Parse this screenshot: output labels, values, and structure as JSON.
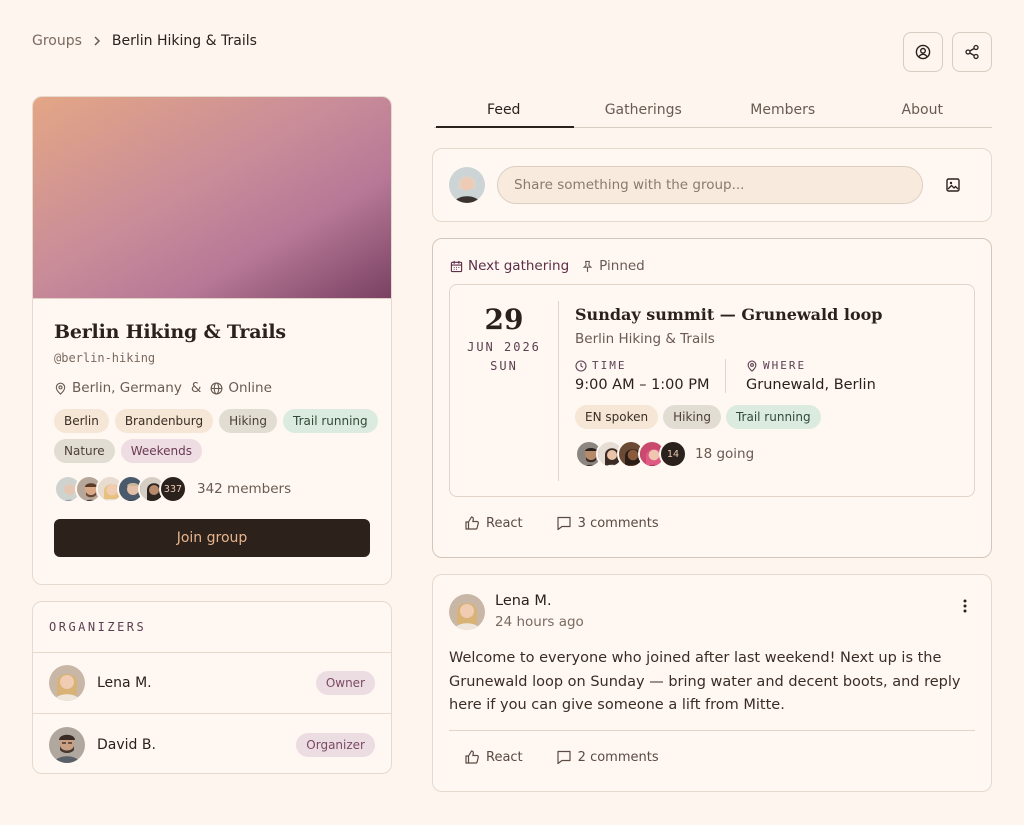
{
  "breadcrumb": {
    "parent": "Groups",
    "current": "Berlin Hiking & Trails"
  },
  "group": {
    "name": "Berlin Hiking & Trails",
    "handle": "@berlin-hiking",
    "location": "Berlin, Germany",
    "location_sep": "&",
    "online": "Online",
    "tags": [
      {
        "label": "Berlin",
        "style": "neutral"
      },
      {
        "label": "Brandenburg",
        "style": "neutral"
      },
      {
        "label": "Hiking",
        "style": "grey"
      },
      {
        "label": "Trail running",
        "style": "green"
      },
      {
        "label": "Nature",
        "style": "grey"
      },
      {
        "label": "Weekends",
        "style": "pink"
      }
    ],
    "members_more": "337",
    "members_text": "342 members",
    "join_label": "Join group"
  },
  "organizers": {
    "title": "ORGANIZERS",
    "items": [
      {
        "name": "Lena M.",
        "role": "Owner"
      },
      {
        "name": "David B.",
        "role": "Organizer"
      }
    ]
  },
  "tabs": [
    "Feed",
    "Gatherings",
    "Members",
    "About"
  ],
  "active_tab": "Feed",
  "composer": {
    "placeholder": "Share something with the group..."
  },
  "gathering": {
    "header_label": "Next gathering",
    "pinned_label": "Pinned",
    "day": "29",
    "month_year": "JUN 2026",
    "weekday": "SUN",
    "title": "Sunday summit — Grunewald loop",
    "group": "Berlin Hiking & Trails",
    "time_label": "TIME",
    "time_value": "9:00 AM – 1:00 PM",
    "where_label": "WHERE",
    "where_value": "Grunewald, Berlin",
    "tags": [
      {
        "label": "EN spoken",
        "style": "neutral"
      },
      {
        "label": "Hiking",
        "style": "grey"
      },
      {
        "label": "Trail running",
        "style": "green"
      }
    ],
    "going_more": "14",
    "going_text": "18 going",
    "react_label": "React",
    "comments_label": "3 comments"
  },
  "post": {
    "author": "Lena M.",
    "time": "24 hours ago",
    "text": "Welcome to everyone who joined after last weekend! Next up is the Grunewald loop on Sunday — bring water and decent boots, and reply here if you can give someone a lift from Mitte.",
    "react_label": "React",
    "comments_label": "2 comments"
  },
  "colors": {
    "accent": "#5b2d48",
    "dark": "#2c211b",
    "join_text": "#e8b48d"
  },
  "icons": [
    "chevron-right-icon",
    "user-circle-icon",
    "share-icon",
    "map-pin-icon",
    "globe-icon",
    "image-icon",
    "calendar-icon",
    "pin-icon",
    "clock-icon",
    "thumbs-up-icon",
    "comment-icon",
    "more-vertical-icon"
  ]
}
